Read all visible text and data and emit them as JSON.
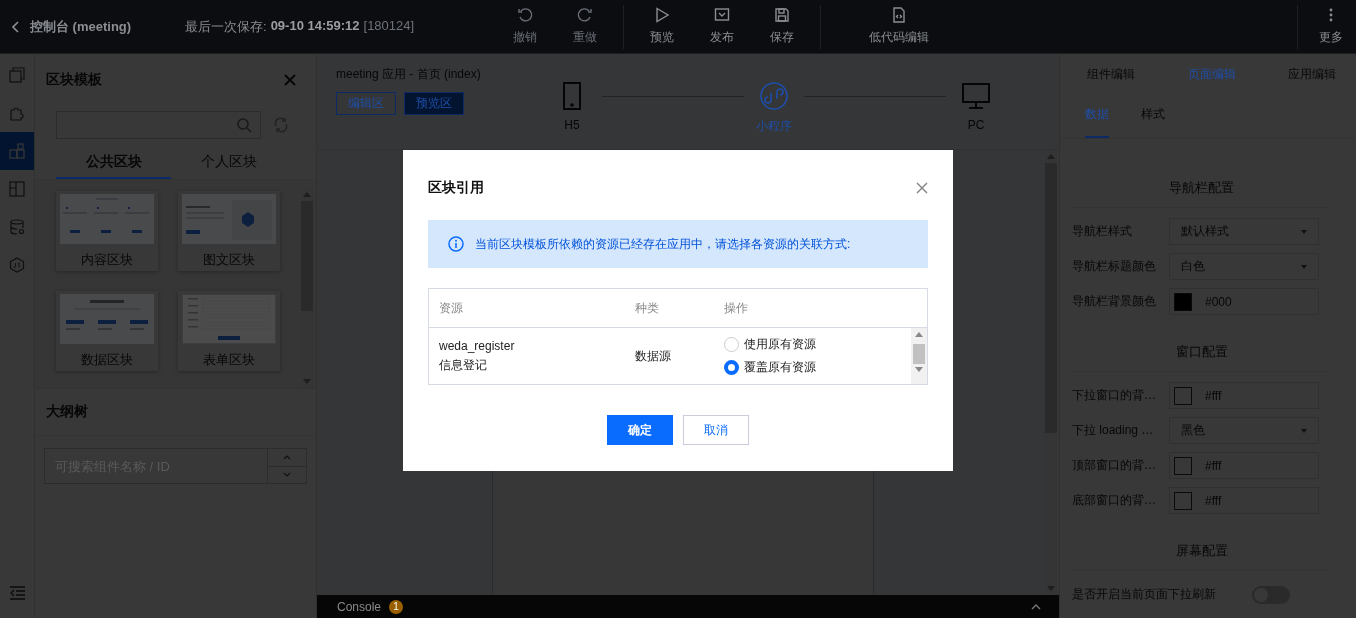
{
  "top_bar": {
    "back": "控制台 (meeting)",
    "save_label": "最后一次保存:",
    "save_time": "09-10 14:59:12",
    "version": "[180124]",
    "tools": [
      {
        "kind": "undo",
        "label": "撤销",
        "disabled": true
      },
      {
        "kind": "redo",
        "label": "重做",
        "disabled": true
      },
      {
        "kind": "preview",
        "label": "预览",
        "disabled": false
      },
      {
        "kind": "publish",
        "label": "发布",
        "disabled": false
      },
      {
        "kind": "save",
        "label": "保存",
        "disabled": false
      },
      {
        "kind": "code",
        "label": "低代码编辑",
        "disabled": false
      }
    ],
    "more": "更多"
  },
  "rail": [
    {
      "kind": "pages",
      "selected": false
    },
    {
      "kind": "components",
      "selected": false
    },
    {
      "kind": "blocks",
      "selected": true
    },
    {
      "kind": "templates",
      "selected": false
    },
    {
      "kind": "data",
      "selected": false
    },
    {
      "kind": "js",
      "selected": false
    }
  ],
  "block_panel": {
    "title": "区块模板",
    "tabs": [
      {
        "label": "公共区块",
        "selected": true
      },
      {
        "label": "个人区块",
        "selected": false
      }
    ],
    "cards": [
      {
        "kind": "content",
        "label": "内容区块"
      },
      {
        "kind": "image_text",
        "label": "图文区块"
      },
      {
        "kind": "data",
        "label": "数据区块"
      },
      {
        "kind": "form",
        "label": "表单区块"
      }
    ]
  },
  "outline": {
    "title": "大纲树",
    "search": {
      "placeholder": "可搜索组件名称 / ID"
    }
  },
  "canvas": {
    "breadcrumb": "meeting 应用 - 首页 (index)",
    "modes": [
      {
        "label": "编辑区",
        "selected": false
      },
      {
        "label": "预览区",
        "selected": true
      }
    ],
    "devices": [
      {
        "kind": "phone",
        "label": "H5",
        "selected": false
      },
      {
        "kind": "mini",
        "label": "小程序",
        "selected": true
      },
      {
        "kind": "desktop",
        "label": "PC",
        "selected": false
      }
    ]
  },
  "console": {
    "label": "Console",
    "count": "1"
  },
  "inspector": {
    "tabs": [
      {
        "label": "组件编辑",
        "selected": false
      },
      {
        "label": "页面编辑",
        "selected": true
      },
      {
        "label": "应用编辑",
        "selected": false
      }
    ],
    "subtabs": [
      {
        "label": "数据",
        "selected": true
      },
      {
        "label": "样式",
        "selected": false
      }
    ],
    "sections": [
      {
        "title": "导航栏配置",
        "rows": [
          {
            "kind": "select",
            "label": "导航栏样式",
            "value": "默认样式"
          },
          {
            "kind": "select",
            "label": "导航栏标题颜色",
            "value": "白色"
          },
          {
            "kind": "color",
            "label": "导航栏背景颜色",
            "value": "#000"
          }
        ]
      },
      {
        "title": "窗口配置",
        "rows": [
          {
            "kind": "color",
            "label": "下拉窗口的背…",
            "value": "#fff"
          },
          {
            "kind": "select",
            "label": "下拉 loading …",
            "value": "黑色"
          },
          {
            "kind": "color",
            "label": "顶部窗口的背…",
            "value": "#fff"
          },
          {
            "kind": "color",
            "label": "底部窗口的背…",
            "value": "#fff"
          }
        ]
      },
      {
        "title": "屏幕配置",
        "rows": [
          {
            "kind": "switch",
            "label": "是否开启当前页面下拉刷新",
            "on": false
          }
        ]
      }
    ]
  },
  "dialog": {
    "title": "区块引用",
    "notice": "当前区块模板所依赖的资源已经存在应用中，请选择各资源的关联方式:",
    "columns": [
      "资源",
      "种类",
      "操作"
    ],
    "rows": [
      {
        "name": "weda_register",
        "title": "信息登记",
        "type": "数据源",
        "options": [
          {
            "label": "使用原有资源",
            "selected": false
          },
          {
            "label": "覆盖原有资源",
            "selected": true
          }
        ]
      }
    ],
    "buttons": [
      {
        "kind": "primary",
        "label": "确定"
      },
      {
        "kind": "default",
        "label": "取消"
      }
    ]
  }
}
